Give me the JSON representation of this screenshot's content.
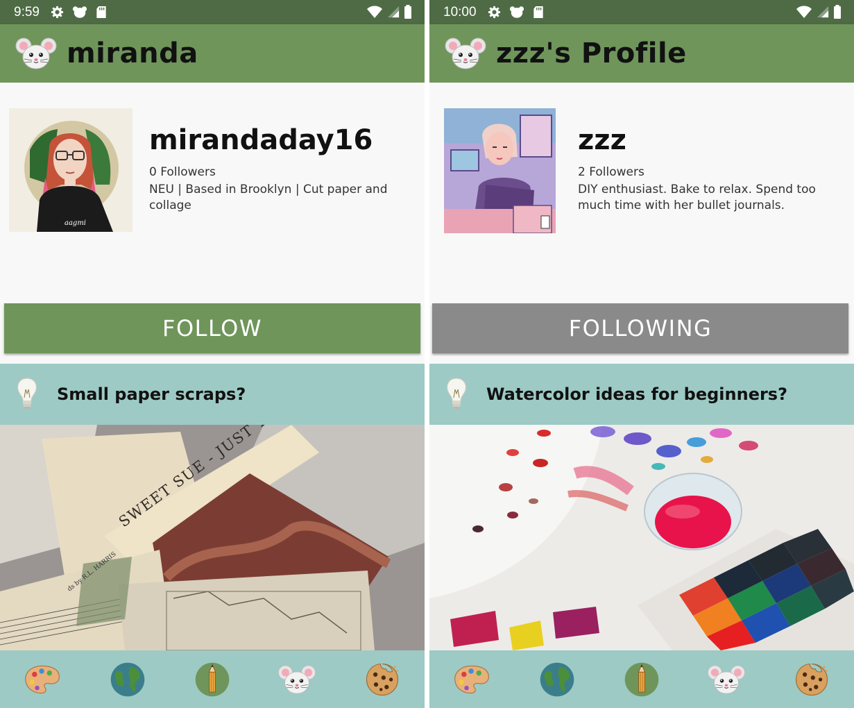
{
  "screens": [
    {
      "status": {
        "time": "9:59"
      },
      "app_bar": {
        "title": "miranda"
      },
      "profile": {
        "username": "mirandaday16",
        "followers": "0 Followers",
        "bio": "NEU | Based in Brooklyn | Cut paper and collage"
      },
      "follow_button": {
        "label": "FOLLOW",
        "color": "#6f955b"
      },
      "post": {
        "question": "Small paper scraps?"
      },
      "image_text": {
        "strip_text": "SWEET SUE - JUST YO",
        "credit": "ds by R.L. HARRIS"
      }
    },
    {
      "status": {
        "time": "10:00"
      },
      "app_bar": {
        "title": "zzz's Profile"
      },
      "profile": {
        "username": "zzz",
        "followers": "2 Followers",
        "bio": "DIY enthusiast. Bake to relax. Spend too much time with her bullet journals."
      },
      "follow_button": {
        "label": "FOLLOWING",
        "color": "#8a8a8a"
      },
      "post": {
        "question": "Watercolor ideas for beginners?"
      }
    }
  ],
  "nav": [
    "palette-icon",
    "globe-icon",
    "pencil-icon",
    "mouse-icon",
    "cookie-icon"
  ],
  "colors": {
    "status_bar": "#4e6b45",
    "app_bar": "#6f955b",
    "teal": "#9dcac5"
  }
}
